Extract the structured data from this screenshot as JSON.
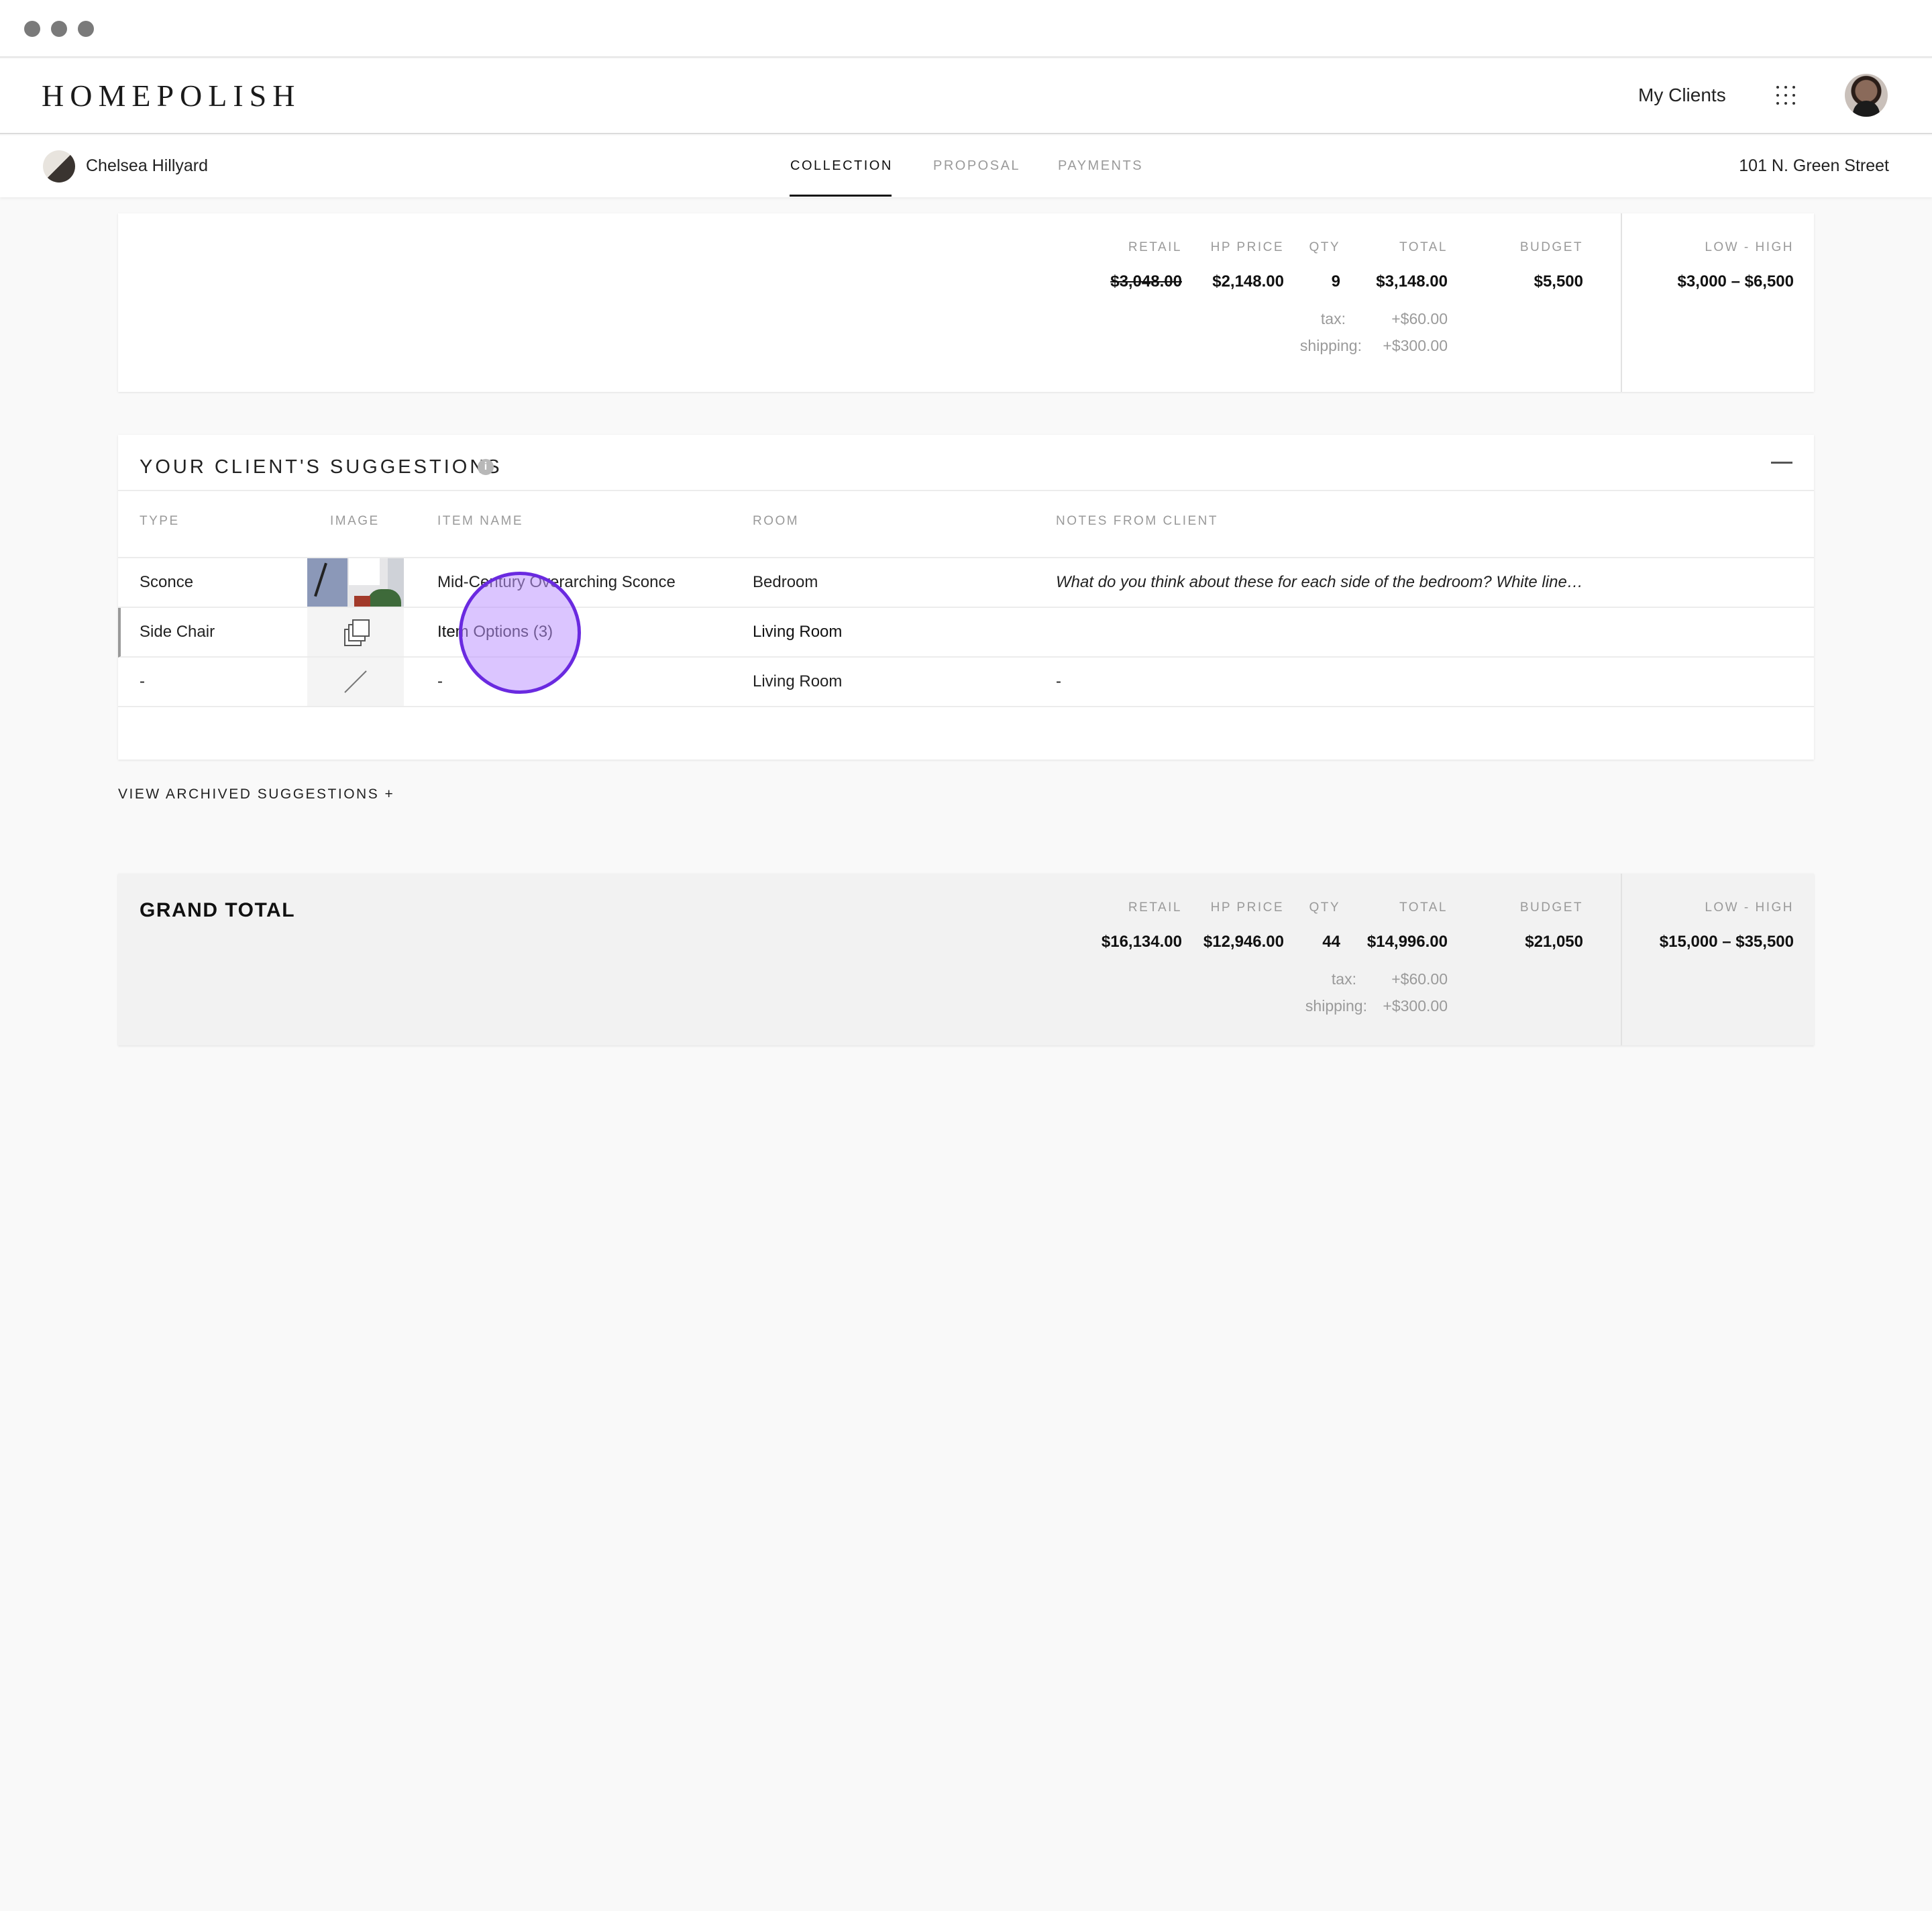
{
  "app": {
    "logo": "HOMEPOLISH"
  },
  "header": {
    "my_clients": "My Clients",
    "grid_icon": "apps-grid-icon",
    "avatar": "user-avatar"
  },
  "subnav": {
    "client_name": "Chelsea Hillyard",
    "tabs": [
      {
        "label": "COLLECTION",
        "active": true
      },
      {
        "label": "PROPOSAL",
        "active": false
      },
      {
        "label": "PAYMENTS",
        "active": false
      }
    ],
    "address": "101 N. Green Street"
  },
  "summary": {
    "headers": {
      "retail": "RETAIL",
      "hp_price": "HP PRICE",
      "qty": "QTY",
      "total": "TOTAL",
      "budget": "BUDGET",
      "range": "LOW - HIGH"
    },
    "retail": "$3,048.00",
    "hp_price": "$2,148.00",
    "qty": "9",
    "total": "$3,148.00",
    "budget": "$5,500",
    "range": "$3,000 – $6,500",
    "tax_label": "tax:",
    "tax_value": "+$60.00",
    "shipping_label": "shipping:",
    "shipping_value": "+$300.00"
  },
  "suggestions": {
    "title": "YOUR CLIENT'S SUGGESTIONS",
    "info_icon": "i",
    "columns": {
      "type": "TYPE",
      "image": "IMAGE",
      "item_name": "ITEM NAME",
      "room": "ROOM",
      "notes": "NOTES FROM CLIENT"
    },
    "rows": [
      {
        "type": "Sconce",
        "image": "sconce-photo",
        "item_name": "Mid-Century Overarching Sconce",
        "room": "Bedroom",
        "notes": "What do you think about these for each side of the bedroom? White line…"
      },
      {
        "type": "Side Chair",
        "image": "item-options-icon",
        "item_name": "Item Options (3)",
        "room": "Living Room",
        "notes": ""
      },
      {
        "type": "-",
        "image": "no-image-icon",
        "item_name": "-",
        "room": "Living Room",
        "notes": "-"
      }
    ],
    "view_archived": "VIEW ARCHIVED SUGGESTIONS +"
  },
  "grand_total": {
    "title": "GRAND TOTAL",
    "headers": {
      "retail": "RETAIL",
      "hp_price": "HP PRICE",
      "qty": "QTY",
      "total": "TOTAL",
      "budget": "BUDGET",
      "range": "LOW - HIGH"
    },
    "retail": "$16,134.00",
    "hp_price": "$12,946.00",
    "qty": "44",
    "total": "$14,996.00",
    "budget": "$21,050",
    "range": "$15,000 – $35,500",
    "tax_label": "tax:",
    "tax_value": "+$60.00",
    "shipping_label": "shipping:",
    "shipping_value": "+$300.00"
  },
  "colors": {
    "accent_marker": "#6a2ae0",
    "marker_fill": "#be96ff"
  }
}
